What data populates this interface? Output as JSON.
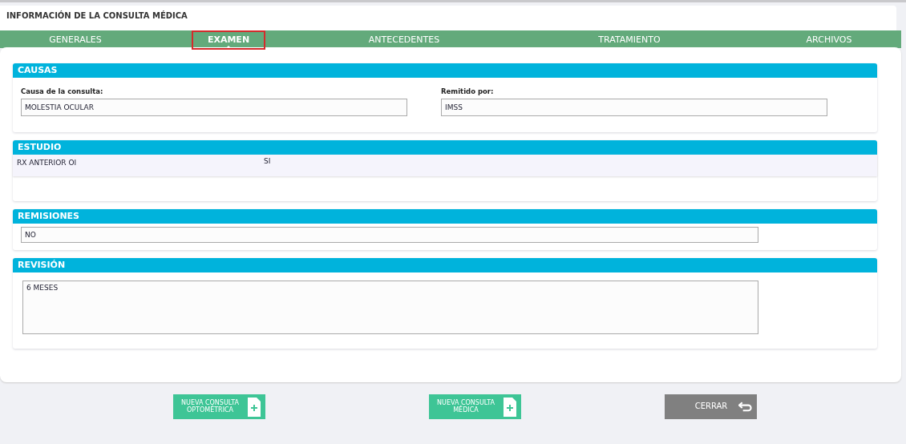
{
  "header": {
    "title": "INFORMACIÓN DE LA CONSULTA MÉDICA"
  },
  "tabs": [
    {
      "label": "GENERALES",
      "selected": false
    },
    {
      "label": "EXAMEN",
      "selected": true
    },
    {
      "label": "ANTECEDENTES",
      "selected": false
    },
    {
      "label": "TRATAMIENTO",
      "selected": false
    },
    {
      "label": "ARCHIVOS",
      "selected": false
    }
  ],
  "causas": {
    "title": "CAUSAS",
    "fields": [
      {
        "label": "Causa de la consulta:",
        "value": "MOLESTIA OCULAR"
      },
      {
        "label": "Remitido por:",
        "value": "IMSS"
      }
    ]
  },
  "estudio": {
    "title": "ESTUDIO",
    "rows": [
      {
        "cells": [
          "RX ANTERIOR OI",
          "SI"
        ]
      }
    ]
  },
  "remisiones": {
    "title": "REMISIONES",
    "value": "NO"
  },
  "revision": {
    "title": "REVISIÓN",
    "value": "6 MESES"
  },
  "buttons": [
    {
      "kind": "new",
      "label": "NUEVA CONSULTA OPTOMÉTRICA"
    },
    {
      "kind": "new",
      "label": "NUEVA CONSULTA MÉDICA"
    },
    {
      "kind": "close",
      "label": "CERRAR"
    }
  ]
}
